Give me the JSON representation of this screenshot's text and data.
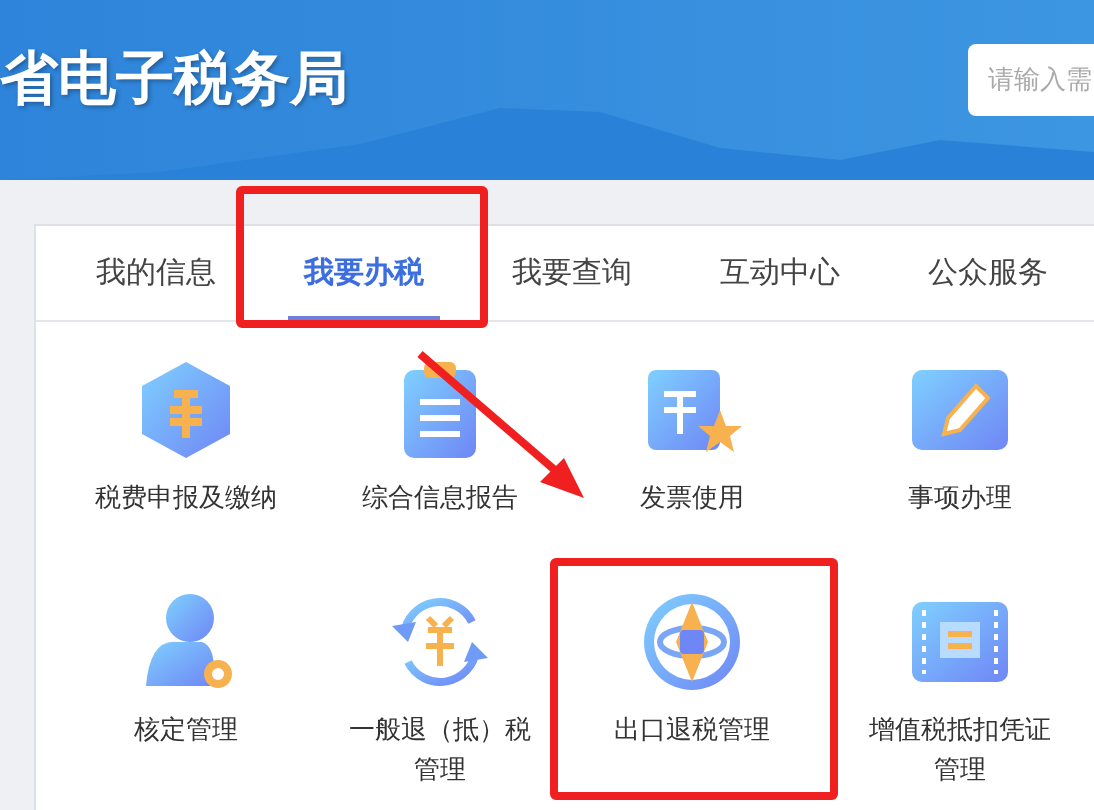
{
  "header": {
    "title": "省电子税务局",
    "search": {
      "placeholder": "请输入需"
    }
  },
  "tabs": [
    {
      "label": "我的信息",
      "selected": false,
      "annotated": false
    },
    {
      "label": "我要办税",
      "selected": true,
      "annotated": true
    },
    {
      "label": "我要查询",
      "selected": false,
      "annotated": false
    },
    {
      "label": "互动中心",
      "selected": false,
      "annotated": false
    },
    {
      "label": "公众服务",
      "selected": false,
      "annotated": false
    }
  ],
  "tiles": [
    {
      "label": "税费申报及缴纳",
      "annotated": false
    },
    {
      "label": "综合信息报告",
      "annotated": false
    },
    {
      "label": "发票使用",
      "annotated": false
    },
    {
      "label": "事项办理",
      "annotated": false
    },
    {
      "label": "核定管理",
      "annotated": false
    },
    {
      "label": "一般退（抵）税管理",
      "annotated": false
    },
    {
      "label": "出口退税管理",
      "annotated": true
    },
    {
      "label": "增值税抵扣凭证管理",
      "annotated": false
    }
  ],
  "annotation_arrow": true
}
